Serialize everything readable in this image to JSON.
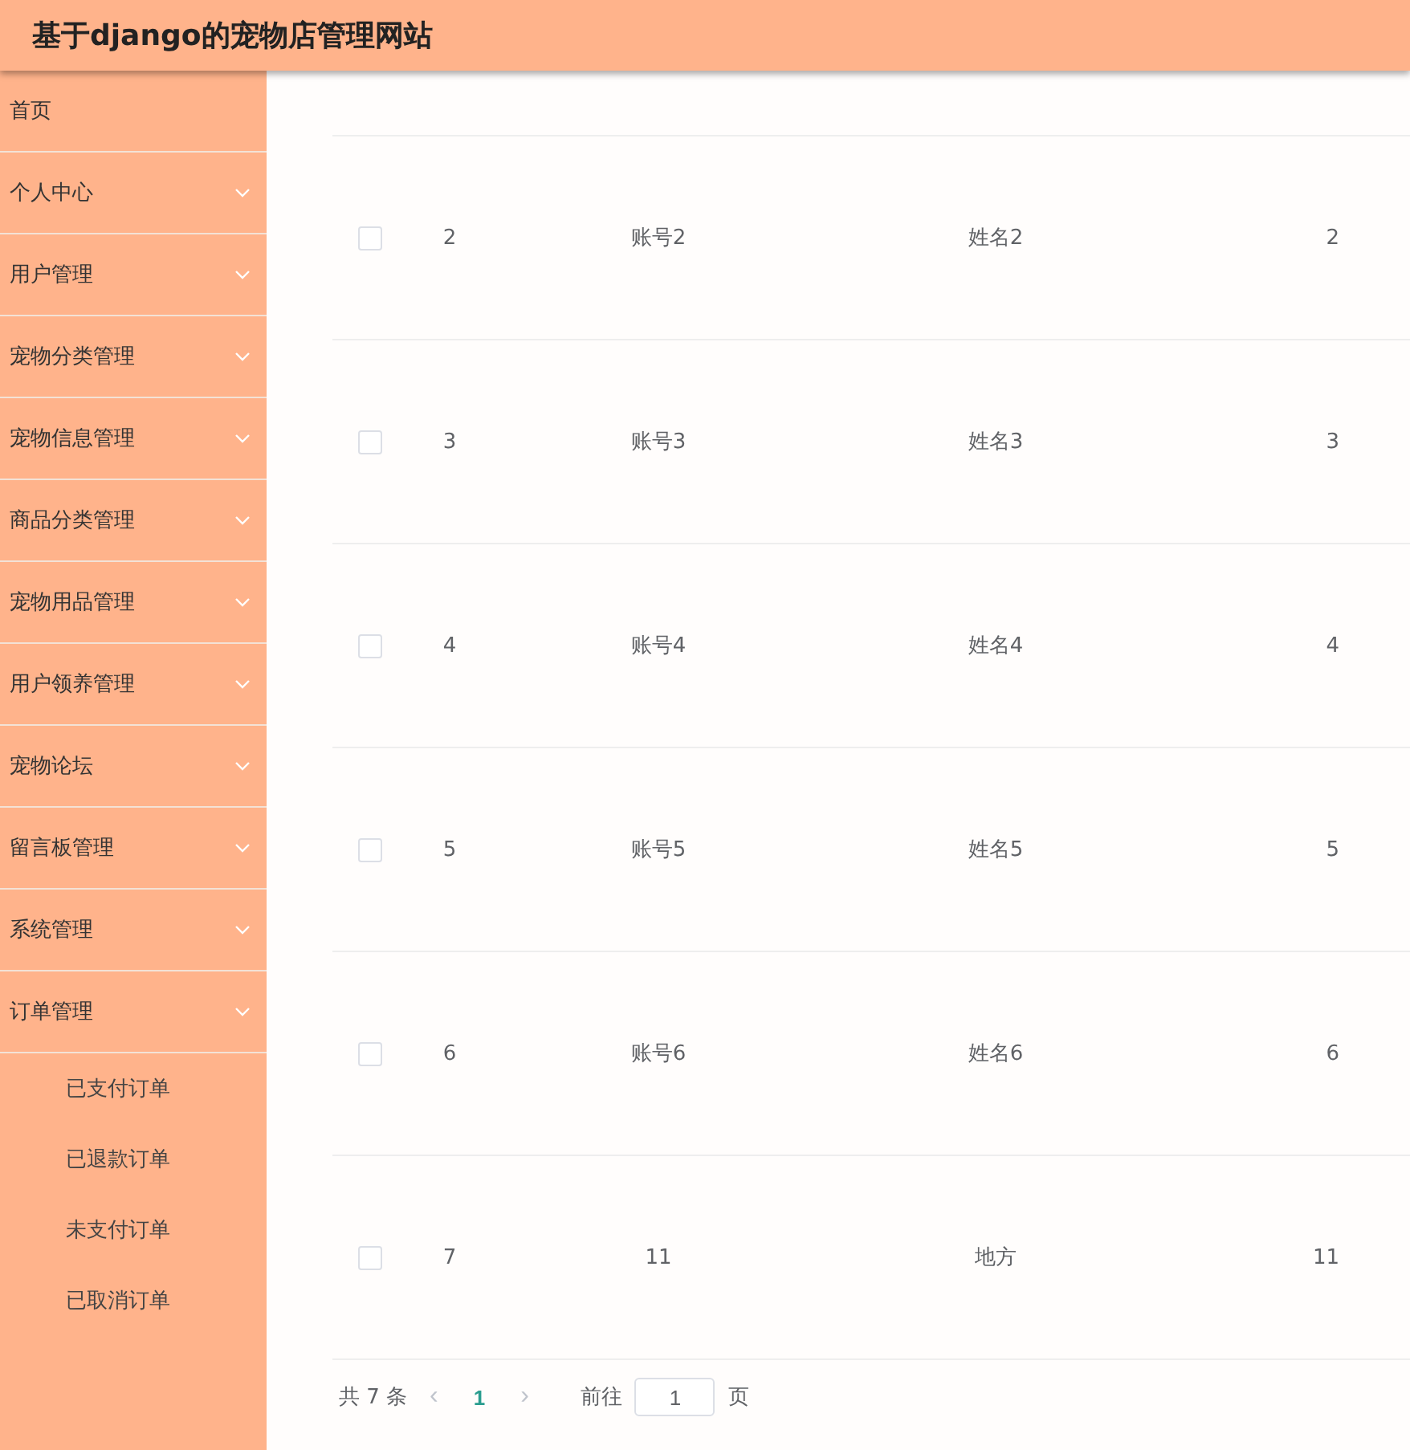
{
  "header": {
    "title": "基于django的宠物店管理网站"
  },
  "sidebar": {
    "items": [
      {
        "label": "首页",
        "has_menu": false
      },
      {
        "label": "个人中心",
        "has_menu": true
      },
      {
        "label": "用户管理",
        "has_menu": true
      },
      {
        "label": "宠物分类管理",
        "has_menu": true
      },
      {
        "label": "宠物信息管理",
        "has_menu": true
      },
      {
        "label": "商品分类管理",
        "has_menu": true
      },
      {
        "label": "宠物用品管理",
        "has_menu": true
      },
      {
        "label": "用户领养管理",
        "has_menu": true
      },
      {
        "label": "宠物论坛",
        "has_menu": true
      },
      {
        "label": "留言板管理",
        "has_menu": true
      },
      {
        "label": "系统管理",
        "has_menu": true
      },
      {
        "label": "订单管理",
        "has_menu": true,
        "children": [
          {
            "label": "已支付订单"
          },
          {
            "label": "已退款订单"
          },
          {
            "label": "未支付订单"
          },
          {
            "label": "已取消订单"
          }
        ]
      }
    ]
  },
  "table": {
    "rows": [
      {
        "checked": false,
        "cells": [
          "2",
          "账号2",
          "姓名2",
          "2"
        ]
      },
      {
        "checked": false,
        "cells": [
          "3",
          "账号3",
          "姓名3",
          "3"
        ]
      },
      {
        "checked": false,
        "cells": [
          "4",
          "账号4",
          "姓名4",
          "4"
        ]
      },
      {
        "checked": false,
        "cells": [
          "5",
          "账号5",
          "姓名5",
          "5"
        ]
      },
      {
        "checked": false,
        "cells": [
          "6",
          "账号6",
          "姓名6",
          "6"
        ]
      },
      {
        "checked": false,
        "cells": [
          "7",
          "11",
          "地方",
          "11"
        ]
      }
    ]
  },
  "pagination": {
    "total": "共 7 条",
    "prev": "‹",
    "pages": [
      {
        "label": "1",
        "selected": true
      }
    ],
    "next": "›",
    "goto_label": "前往",
    "goto_value": "1",
    "page_suffix": "页"
  }
}
